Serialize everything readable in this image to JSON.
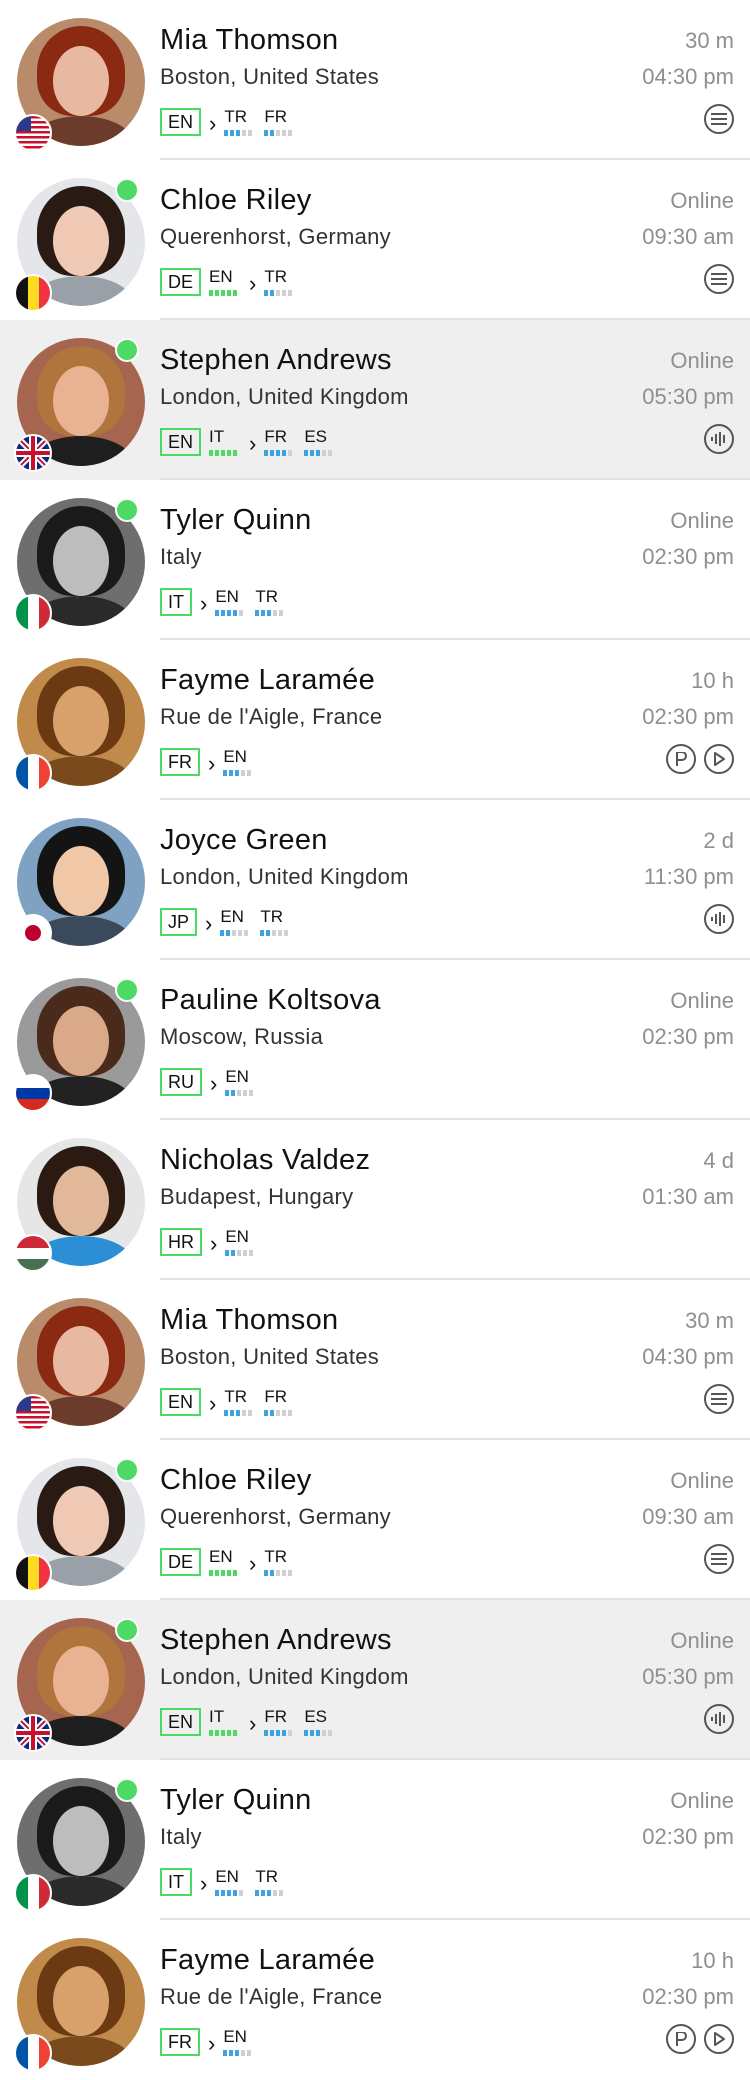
{
  "contacts": [
    {
      "name": "Mia Thomson",
      "place": "Boston, United States",
      "status": "30 m",
      "time": "04:30 pm",
      "online": false,
      "flag": "us-flag-icon",
      "native": "EN",
      "learn": [],
      "targets": [
        {
          "code": "TR",
          "level": 3
        },
        {
          "code": "FR",
          "level": 2
        }
      ],
      "actions": [
        "menu-icon"
      ],
      "highlight": false,
      "avatar": {
        "hair": "#8a2a12",
        "face": "#e8b9a0",
        "body": "#6b3b2b",
        "bg": "#b98b6a"
      }
    },
    {
      "name": "Chloe Riley",
      "place": "Querenhorst, Germany",
      "status": "Online",
      "time": "09:30 am",
      "online": true,
      "flag": "be-flag-icon",
      "native": "DE",
      "learn": [
        {
          "code": "EN",
          "level": 5
        }
      ],
      "targets": [
        {
          "code": "TR",
          "level": 2
        }
      ],
      "actions": [
        "menu-icon"
      ],
      "highlight": false,
      "avatar": {
        "hair": "#2a1a14",
        "face": "#f0c9b4",
        "body": "#9aa0a8",
        "bg": "#e4e6ea"
      }
    },
    {
      "name": "Stephen Andrews",
      "place": "London, United Kingdom",
      "status": "Online",
      "time": "05:30 pm",
      "online": true,
      "flag": "uk-flag-icon",
      "native": "EN",
      "learn": [
        {
          "code": "IT",
          "level": 5
        }
      ],
      "targets": [
        {
          "code": "FR",
          "level": 4
        },
        {
          "code": "ES",
          "level": 3
        }
      ],
      "actions": [
        "audio-icon"
      ],
      "highlight": true,
      "avatar": {
        "hair": "#b0753c",
        "face": "#e8b293",
        "body": "#1e1e1e",
        "bg": "#a5654f"
      }
    },
    {
      "name": "Tyler Quinn",
      "place": "Italy",
      "status": "Online",
      "time": "02:30 pm",
      "online": true,
      "flag": "it-flag-icon",
      "native": "IT",
      "learn": [],
      "targets": [
        {
          "code": "EN",
          "level": 4
        },
        {
          "code": "TR",
          "level": 3
        }
      ],
      "actions": [],
      "highlight": false,
      "avatar": {
        "hair": "#1a1a1a",
        "face": "#bdbdbd",
        "body": "#2a2a2a",
        "bg": "#6e6e6e"
      }
    },
    {
      "name": "Fayme Laramée",
      "place": "Rue de l'Aigle, France",
      "status": "10 h",
      "time": "02:30 pm",
      "online": false,
      "flag": "fr-flag-icon",
      "native": "FR",
      "learn": [],
      "targets": [
        {
          "code": "EN",
          "level": 3
        }
      ],
      "actions": [
        "p-icon",
        "play-icon"
      ],
      "highlight": false,
      "avatar": {
        "hair": "#6b3a12",
        "face": "#d8a06a",
        "body": "#7a4a1c",
        "bg": "#c08a4a"
      }
    },
    {
      "name": "Joyce Green",
      "place": "London, United Kingdom",
      "status": "2 d",
      "time": "11:30 pm",
      "online": false,
      "flag": "jp-flag-icon",
      "native": "JP",
      "learn": [],
      "targets": [
        {
          "code": "EN",
          "level": 2
        },
        {
          "code": "TR",
          "level": 2
        }
      ],
      "actions": [
        "audio-icon"
      ],
      "highlight": false,
      "avatar": {
        "hair": "#141414",
        "face": "#f0c8a8",
        "body": "#3a4a5a",
        "bg": "#7fa2c2"
      }
    },
    {
      "name": "Pauline Koltsova",
      "place": "Moscow, Russia",
      "status": "Online",
      "time": "02:30 pm",
      "online": true,
      "flag": "ru-flag-icon",
      "native": "RU",
      "learn": [],
      "targets": [
        {
          "code": "EN",
          "level": 2
        }
      ],
      "actions": [],
      "highlight": false,
      "avatar": {
        "hair": "#4a2a1a",
        "face": "#d9a98a",
        "body": "#222222",
        "bg": "#9a9a9a"
      }
    },
    {
      "name": "Nicholas Valdez",
      "place": "Budapest, Hungary",
      "status": "4 d",
      "time": "01:30 am",
      "online": false,
      "flag": "hu-flag-icon",
      "native": "HR",
      "learn": [],
      "targets": [
        {
          "code": "EN",
          "level": 2
        }
      ],
      "actions": [],
      "highlight": false,
      "avatar": {
        "hair": "#2a1a12",
        "face": "#e2b89a",
        "body": "#2c8fd6",
        "bg": "#e6e6e6"
      }
    },
    {
      "name": "Mia Thomson",
      "place": "Boston, United States",
      "status": "30 m",
      "time": "04:30 pm",
      "online": false,
      "flag": "us-flag-icon",
      "native": "EN",
      "learn": [],
      "targets": [
        {
          "code": "TR",
          "level": 3
        },
        {
          "code": "FR",
          "level": 2
        }
      ],
      "actions": [
        "menu-icon"
      ],
      "highlight": false,
      "avatar": {
        "hair": "#8a2a12",
        "face": "#e8b9a0",
        "body": "#6b3b2b",
        "bg": "#b98b6a"
      }
    },
    {
      "name": "Chloe Riley",
      "place": "Querenhorst, Germany",
      "status": "Online",
      "time": "09:30 am",
      "online": true,
      "flag": "be-flag-icon",
      "native": "DE",
      "learn": [
        {
          "code": "EN",
          "level": 5
        }
      ],
      "targets": [
        {
          "code": "TR",
          "level": 2
        }
      ],
      "actions": [
        "menu-icon"
      ],
      "highlight": false,
      "avatar": {
        "hair": "#2a1a14",
        "face": "#f0c9b4",
        "body": "#9aa0a8",
        "bg": "#e4e6ea"
      }
    },
    {
      "name": "Stephen Andrews",
      "place": "London, United Kingdom",
      "status": "Online",
      "time": "05:30 pm",
      "online": true,
      "flag": "uk-flag-icon",
      "native": "EN",
      "learn": [
        {
          "code": "IT",
          "level": 5
        }
      ],
      "targets": [
        {
          "code": "FR",
          "level": 4
        },
        {
          "code": "ES",
          "level": 3
        }
      ],
      "actions": [
        "audio-icon"
      ],
      "highlight": true,
      "avatar": {
        "hair": "#b0753c",
        "face": "#e8b293",
        "body": "#1e1e1e",
        "bg": "#a5654f"
      }
    },
    {
      "name": "Tyler Quinn",
      "place": "Italy",
      "status": "Online",
      "time": "02:30 pm",
      "online": true,
      "flag": "it-flag-icon",
      "native": "IT",
      "learn": [],
      "targets": [
        {
          "code": "EN",
          "level": 4
        },
        {
          "code": "TR",
          "level": 3
        }
      ],
      "actions": [],
      "highlight": false,
      "avatar": {
        "hair": "#1a1a1a",
        "face": "#bdbdbd",
        "body": "#2a2a2a",
        "bg": "#6e6e6e"
      }
    },
    {
      "name": "Fayme Laramée",
      "place": "Rue de l'Aigle, France",
      "status": "10 h",
      "time": "02:30 pm",
      "online": false,
      "flag": "fr-flag-icon",
      "native": "FR",
      "learn": [],
      "targets": [
        {
          "code": "EN",
          "level": 3
        }
      ],
      "actions": [
        "p-icon",
        "play-icon"
      ],
      "highlight": false,
      "avatar": {
        "hair": "#6b3a12",
        "face": "#d8a06a",
        "body": "#7a4a1c",
        "bg": "#c08a4a"
      }
    }
  ],
  "colors": {
    "online": "#4cd964",
    "native_border": "#4cd964",
    "learn_bar": "#4cd964",
    "target_bar": "#3ba4e0",
    "highlight_row": "#efefef"
  }
}
